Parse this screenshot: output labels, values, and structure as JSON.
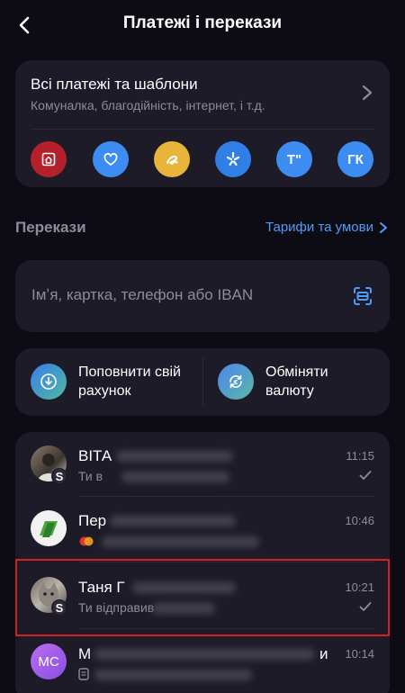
{
  "header": {
    "title": "Платежі і перекази"
  },
  "payments_card": {
    "title": "Всі платежі та шаблони",
    "subtitle": "Комуналка, благодійність, інтернет, і т.д.",
    "shortcuts": [
      {
        "icon": "home-icon",
        "color": "#b5212a",
        "label": ""
      },
      {
        "icon": "heart-icon",
        "color": "#3d8cf2",
        "label": ""
      },
      {
        "icon": "lifecell-icon",
        "color": "#e9b43a",
        "label": ""
      },
      {
        "icon": "kyivstar-icon",
        "color": "#2f7fe6",
        "label": ""
      },
      {
        "icon": "letters",
        "color": "#3d8cf2",
        "label": "Т\""
      },
      {
        "icon": "letters",
        "color": "#3d8cf2",
        "label": "ГК"
      }
    ]
  },
  "transfers": {
    "section_label": "Перекази",
    "tariffs_link": "Тарифи та умови",
    "search_placeholder": "Імʼя, картка, телефон або IBAN"
  },
  "actions": {
    "topup": "Поповнити свій рахунок",
    "exchange": "Обміняти валюту"
  },
  "chats": [
    {
      "name": "ВІТА",
      "preview": "Ти в",
      "time": "11:15",
      "avatar_type": "photo",
      "badge": "S",
      "status": "read"
    },
    {
      "name": "Пер",
      "preview": "",
      "time": "10:46",
      "avatar_type": "privat",
      "badge": "",
      "status": ""
    },
    {
      "name": "Таня Г",
      "preview": "Ти відправив",
      "time": "10:21",
      "avatar_type": "photo",
      "badge": "S",
      "status": "read"
    },
    {
      "name": "М",
      "name_suffix": "и",
      "preview": "",
      "time": "10:14",
      "avatar_type": "initials",
      "initials": "МС",
      "badge": "",
      "status": ""
    }
  ],
  "colors": {
    "background": "#0d0c15",
    "card": "#1c1b27",
    "accent_link": "#4f9cf7",
    "highlight": "#d81f26"
  }
}
